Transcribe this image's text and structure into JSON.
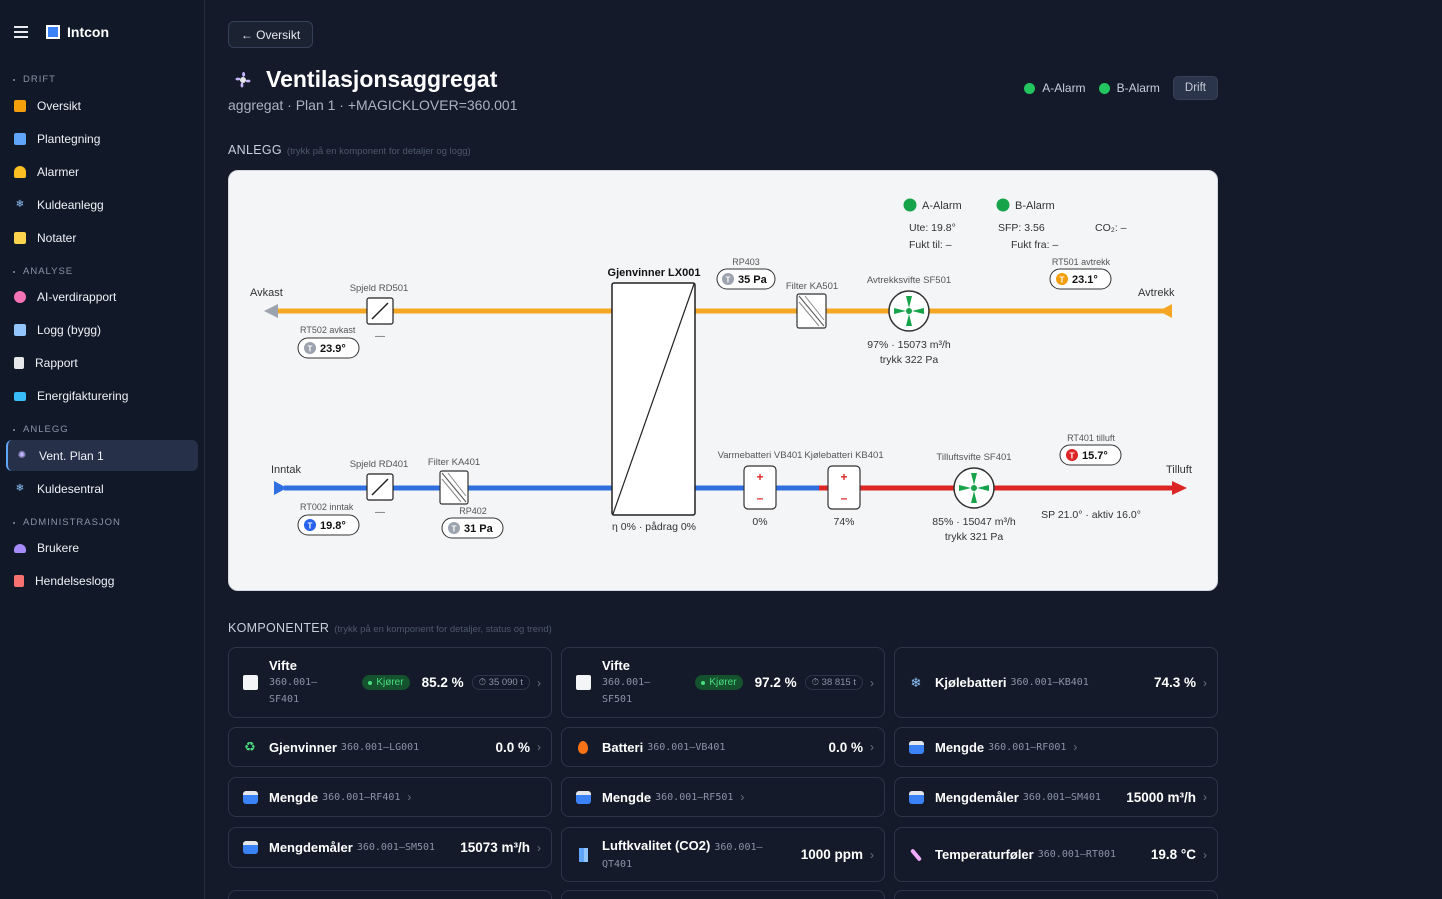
{
  "app": {
    "name": "Intcon"
  },
  "sidebar": {
    "sections": [
      {
        "label": "DRIFT",
        "items": [
          {
            "label": "Oversikt",
            "icon": "house-icon",
            "color": "#f59e0b"
          },
          {
            "label": "Plantegning",
            "icon": "map-icon",
            "color": "#60a5fa"
          },
          {
            "label": "Alarmer",
            "icon": "bell-icon",
            "color": "#fbbf24"
          },
          {
            "label": "Kuldeanlegg",
            "icon": "snowflake-icon",
            "color": "#93c5fd"
          },
          {
            "label": "Notater",
            "icon": "note-icon",
            "color": "#fcd34d"
          }
        ]
      },
      {
        "label": "ANALYSE",
        "items": [
          {
            "label": "AI-verdirapport",
            "icon": "robot-icon",
            "color": "#f472b6"
          },
          {
            "label": "Logg (bygg)",
            "icon": "chart-icon",
            "color": "#93c5fd"
          },
          {
            "label": "Rapport",
            "icon": "document-icon",
            "color": "#e5e7eb"
          },
          {
            "label": "Energifakturering",
            "icon": "invoice-icon",
            "color": "#38bdf8"
          }
        ]
      },
      {
        "label": "ANLEGG",
        "items": [
          {
            "label": "Vent. Plan 1",
            "icon": "fan-icon",
            "color": "#c4b5fd",
            "active": true
          },
          {
            "label": "Kuldesentral",
            "icon": "snowflake-icon",
            "color": "#93c5fd"
          }
        ]
      },
      {
        "label": "ADMINISTRASJON",
        "items": [
          {
            "label": "Brukere",
            "icon": "users-icon",
            "color": "#a78bfa"
          },
          {
            "label": "Hendelseslogg",
            "icon": "log-icon",
            "color": "#f87171"
          }
        ]
      }
    ]
  },
  "header": {
    "back_label": "← Oversikt",
    "title": "Ventilasjonsaggregat",
    "subtitle": "aggregat · Plan 1 · +MAGICKLOVER=360.001",
    "a_alarm": "A-Alarm",
    "b_alarm": "B-Alarm",
    "drift_label": "Drift",
    "status_color": "#22c55e"
  },
  "anlegg": {
    "label": "ANLEGG",
    "hint": "(trykk på en komponent for detaljer og logg)"
  },
  "schematic": {
    "a_alarm": "A-Alarm",
    "b_alarm": "B-Alarm",
    "ute": "Ute: 19.8°",
    "sfp": "SFP: 3.56",
    "co2": "CO₂: –",
    "fukt_til": "Fukt til: –",
    "fukt_fra": "Fukt fra: –",
    "avkast": "Avkast",
    "avtrekk": "Avtrekk",
    "inntak": "Inntak",
    "tilluft": "Tilluft",
    "spjeld_rd501": "Spjeld RD501",
    "spjeld_rd501_state": "—",
    "rt502_label": "RT502 avkast",
    "rt502_value": "23.9°",
    "gjenvinner_label": "Gjenvinner LX001",
    "gjenvinner_status": "η 0% · pådrag 0%",
    "rp403_label": "RP403",
    "rp403_value": "35 Pa",
    "filter_ka501": "Filter KA501",
    "sf501_label": "Avtrekksvifte SF501",
    "sf501_line1": "97% · 15073 m³/h",
    "sf501_line2": "trykk 322 Pa",
    "rt501_label": "RT501 avtrekk",
    "rt501_value": "23.1°",
    "spjeld_rd401": "Spjeld RD401",
    "spjeld_rd401_state": "—",
    "filter_ka401": "Filter KA401",
    "rt002_label": "RT002 inntak",
    "rt002_value": "19.8°",
    "rp402_label": "RP402",
    "rp402_value": "31 Pa",
    "vb401_label": "Varmebatteri VB401",
    "vb401_value": "0%",
    "kb401_label": "Kjølebatteri KB401",
    "kb401_value": "74%",
    "sf401_label": "Tilluftsvifte SF401",
    "sf401_line1": "85% · 15047 m³/h",
    "sf401_line2": "trykk 321 Pa",
    "rt401_label": "RT401 tilluft",
    "rt401_value": "15.7°",
    "sp_text": "SP 21.0° · aktiv 16.0°",
    "colors": {
      "exhaust": "#f5a623",
      "supply_cold": "#2f6fdf",
      "supply_warm": "#dc2626",
      "fan": "#16a34a"
    }
  },
  "komponenter": {
    "label": "KOMPONENTER",
    "hint": "(trykk på en komponent for detaljer, status og trend)",
    "cards": [
      {
        "name": "Vifte",
        "tag1": "360.001–",
        "tag2": "SF401",
        "status": "Kjører",
        "value": "85.2 %",
        "hours": "⏱ 35 090 t",
        "icon": "fan-square-icon"
      },
      {
        "name": "Vifte",
        "tag1": "360.001–",
        "tag2": "SF501",
        "status": "Kjører",
        "value": "97.2 %",
        "hours": "⏱ 38 815 t",
        "icon": "fan-square-icon"
      },
      {
        "name": "Kjølebatteri",
        "tag": "360.001–KB401",
        "value": "74.3 %",
        "icon": "snowflake-icon"
      },
      {
        "name": "Gjenvinner",
        "tag": "360.001–LG001",
        "value": "0.0 %",
        "icon": "recycle-icon"
      },
      {
        "name": "Batteri",
        "tag": "360.001–VB401",
        "value": "0.0 %",
        "icon": "flame-icon"
      },
      {
        "name": "Mengde",
        "tag": "360.001–RF001",
        "value": "",
        "icon": "wave-icon"
      },
      {
        "name": "Mengde",
        "tag": "360.001–RF401",
        "value": "",
        "icon": "wave-icon"
      },
      {
        "name": "Mengde",
        "tag": "360.001–RF501",
        "value": "",
        "icon": "wave-icon"
      },
      {
        "name": "Mengdemåler",
        "tag": "360.001–SM401",
        "value": "15000 m³/h",
        "icon": "wave-icon"
      },
      {
        "name": "Mengdemåler",
        "tag": "360.001–SM501",
        "value": "15073 m³/h",
        "icon": "wave-icon"
      },
      {
        "name": "Luftkvalitet (CO2)",
        "tag1": "360.001–",
        "tag2": "QT401",
        "value": "1000 ppm",
        "icon": "building-icon"
      },
      {
        "name": "Temperaturføler",
        "tag": "360.001–RT001",
        "value": "19.8 °C",
        "icon": "thermometer-icon"
      }
    ]
  }
}
